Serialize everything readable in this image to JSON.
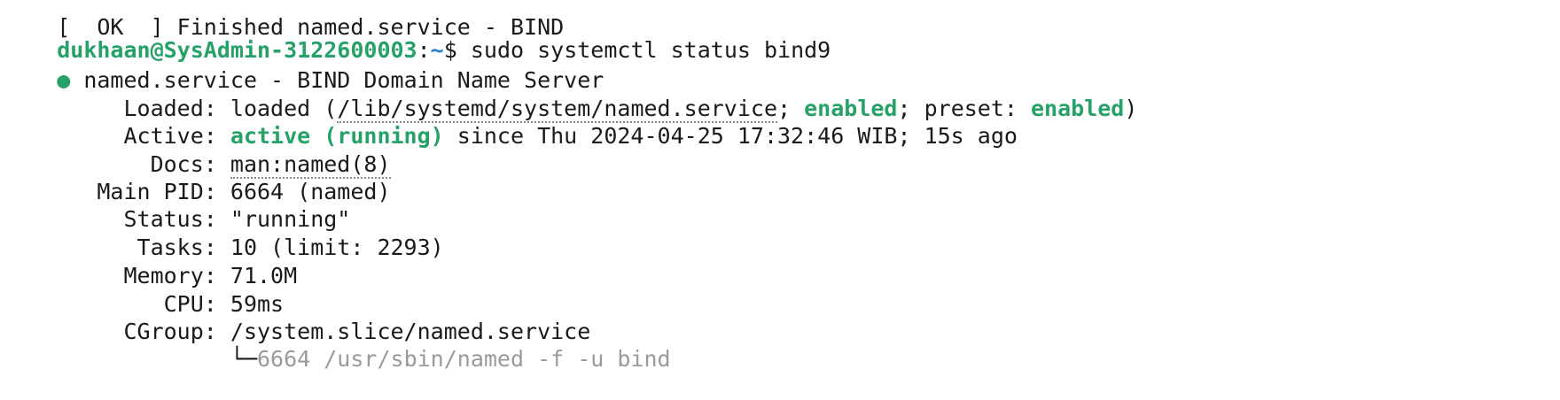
{
  "terminal": {
    "clipped_line": "[  OK  ] Finished named.service - BIND",
    "prompt": {
      "user_host": "dukhaan@SysAdmin-3122600003",
      "colon": ":",
      "path": "~",
      "symbol": "$",
      "command": " sudo systemctl status bind9"
    },
    "service": {
      "bullet": "●",
      "header": " named.service - BIND Domain Name Server",
      "loaded": {
        "label": "     Loaded: ",
        "prefix": "loaded (",
        "path": "/lib/systemd/system/named.service",
        "sep1": "; ",
        "enabled": "enabled",
        "sep2": "; preset: ",
        "preset": "enabled",
        "suffix": ")"
      },
      "active": {
        "label": "     Active: ",
        "state": "active (running)",
        "since": " since Thu 2024-04-25 17:32:46 WIB; 15s ago"
      },
      "docs": {
        "label": "       Docs: ",
        "value": "man:named(8)"
      },
      "main_pid": {
        "label": "   Main PID: ",
        "value": "6664 (named)"
      },
      "status": {
        "label": "     Status: ",
        "value": "\"running\""
      },
      "tasks": {
        "label": "      Tasks: ",
        "value": "10 (limit: 2293)"
      },
      "memory": {
        "label": "     Memory: ",
        "value": "71.0M"
      },
      "cpu": {
        "label": "        CPU: ",
        "value": "59ms"
      },
      "cgroup": {
        "label": "     CGroup: ",
        "value": "/system.slice/named.service",
        "indent": "             ",
        "tree_glyph": "└─",
        "process": "6664 /usr/sbin/named -f -u bind"
      }
    }
  },
  "colors": {
    "background": "#ffffff",
    "text": "#1a1a1a",
    "green": "#26a269",
    "blue": "#2a7bd5",
    "dim": "#9a9a9a"
  }
}
